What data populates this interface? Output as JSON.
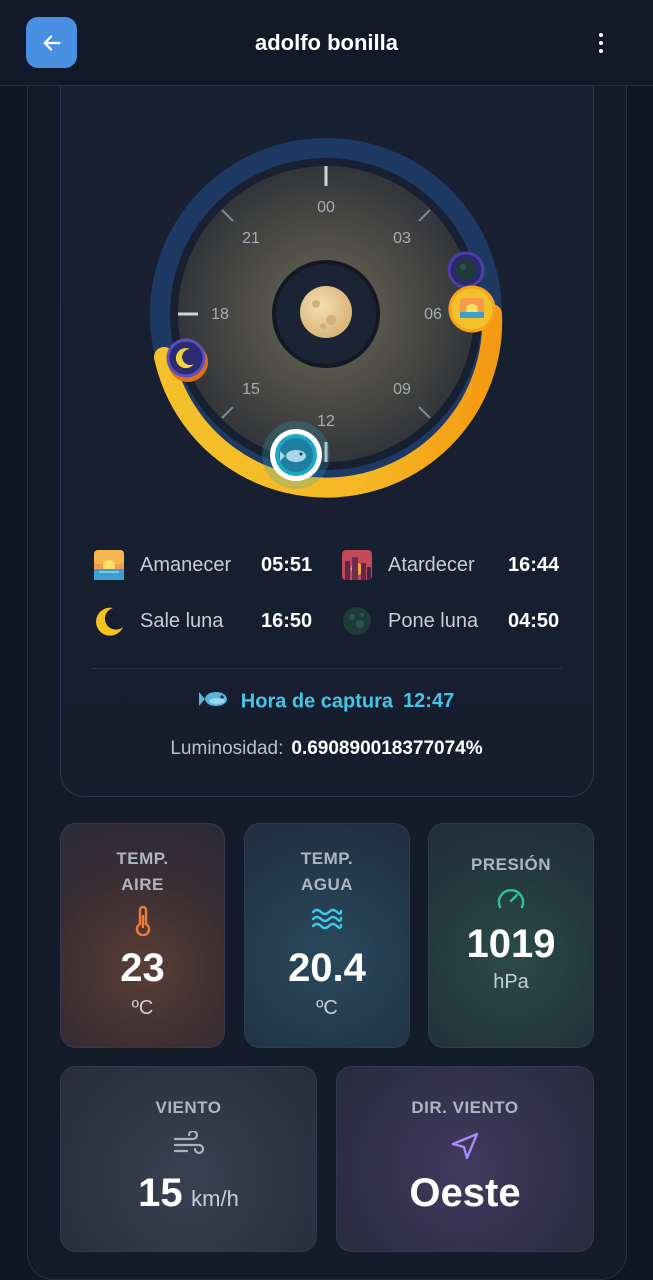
{
  "header": {
    "title": "adolfo bonilla",
    "back_icon": "arrow-left-icon",
    "menu_icon": "more-vertical-icon",
    "accent": "#4a90e2"
  },
  "dial": {
    "hour_labels": [
      "00",
      "03",
      "06",
      "09",
      "12",
      "15",
      "18",
      "21"
    ],
    "center_icon": "moon-phase-icon",
    "markers": [
      "moonset-icon",
      "sunrise-icon",
      "moonrise-icon",
      "fish-capture-icon"
    ]
  },
  "times": {
    "sunrise": {
      "label": "Amanecer",
      "value": "05:51",
      "icon": "sunrise-icon"
    },
    "sunset": {
      "label": "Atardecer",
      "value": "16:44",
      "icon": "sunset-icon"
    },
    "moonrise": {
      "label": "Sale luna",
      "value": "16:50",
      "icon": "crescent-moon-icon"
    },
    "moonset": {
      "label": "Pone luna",
      "value": "04:50",
      "icon": "new-moon-icon"
    }
  },
  "capture": {
    "label": "Hora de captura",
    "value": "12:47",
    "icon": "fish-icon",
    "color": "#46c4e6"
  },
  "luminosity": {
    "label": "Luminosidad:",
    "value": "0.690890018377074%"
  },
  "stats": {
    "air": {
      "label_line1": "TEMP.",
      "label_line2": "AIRE",
      "value": "23",
      "unit": "ºC",
      "icon": "thermometer-icon",
      "color": "#f07a3a"
    },
    "water": {
      "label_line1": "TEMP.",
      "label_line2": "AGUA",
      "value": "20.4",
      "unit": "ºC",
      "icon": "waves-icon",
      "color": "#3ec8e6"
    },
    "pressure": {
      "label": "PRESIÓN",
      "value": "1019",
      "unit": "hPa",
      "icon": "gauge-icon",
      "color": "#2ec4a0"
    },
    "wind": {
      "label": "VIENTO",
      "value": "15",
      "unit": "km/h",
      "icon": "wind-icon"
    },
    "wind_dir": {
      "label": "DIR. VIENTO",
      "value": "Oeste",
      "icon": "navigation-arrow-icon",
      "color": "#a78bfa"
    }
  }
}
